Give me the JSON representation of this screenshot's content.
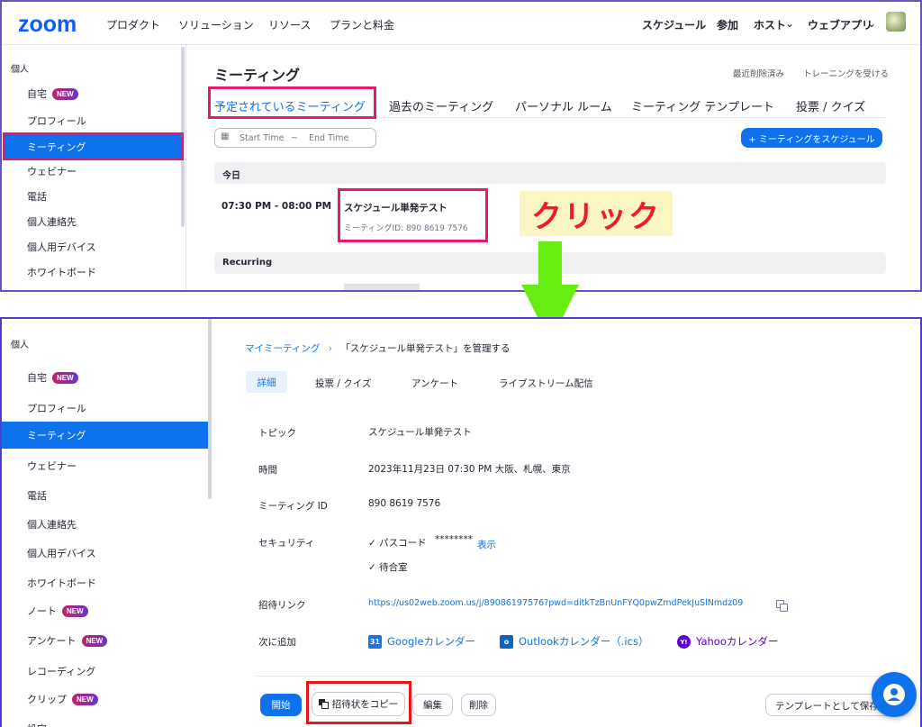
{
  "top": {
    "logo": "zoom",
    "nav_left": [
      "プロダクト",
      "ソリューション",
      "リソース",
      "プランと料金"
    ],
    "nav_right": [
      "スケジュール",
      "参加",
      "ホスト",
      "ウェブアプリ"
    ]
  },
  "sidebar1": {
    "section": "個人",
    "items": [
      "自宅",
      "プロフィール",
      "ミーティング",
      "ウェビナー",
      "電話",
      "個人連絡先",
      "個人用デバイス",
      "ホワイトボード"
    ],
    "new_badge": "NEW"
  },
  "meetings": {
    "title": "ミーティング",
    "links": [
      "最近削除済み",
      "トレーニングを受ける"
    ],
    "tabs": [
      "予定されているミーティング",
      "過去のミーティング",
      "パーソナル ルーム",
      "ミーティング テンプレート",
      "投票 / クイズ"
    ],
    "start_placeholder": "Start Time",
    "end_placeholder": "End Time",
    "date_sep": "~",
    "schedule_button": "+ ミーティングをスケジュール",
    "today_label": "今日",
    "meeting_time": "07:30 PM - 08:00 PM",
    "meeting_topic": "スケジュール単発テスト",
    "meeting_id": "ミーティングID: 890 8619 7576",
    "recurring_label": "Recurring"
  },
  "annotation": {
    "click_text": "クリック",
    "arrow_color": "#66ee11",
    "box_color": "#e6186f"
  },
  "sidebar2": {
    "section": "個人",
    "items": [
      {
        "label": "自宅",
        "new": true
      },
      {
        "label": "プロフィール",
        "new": false
      },
      {
        "label": "ミーティング",
        "new": false
      },
      {
        "label": "ウェビナー",
        "new": false
      },
      {
        "label": "電話",
        "new": false
      },
      {
        "label": "個人連絡先",
        "new": false
      },
      {
        "label": "個人用デバイス",
        "new": false
      },
      {
        "label": "ホワイトボード",
        "new": false
      },
      {
        "label": "ノート",
        "new": true
      },
      {
        "label": "アンケート",
        "new": true
      },
      {
        "label": "レコーディング",
        "new": false
      },
      {
        "label": "クリップ",
        "new": true
      },
      {
        "label": "設定",
        "new": false
      }
    ]
  },
  "detail": {
    "breadcrumb_link": "マイミーティング",
    "breadcrumb_sep": "›",
    "breadcrumb_current": "「スケジュール単発テスト」を管理する",
    "tabs": [
      "詳細",
      "投票 / クイズ",
      "アンケート",
      "ライブストリーム配信"
    ],
    "rows": {
      "topic_label": "トピック",
      "topic": "スケジュール単発テスト",
      "time_label": "時間",
      "time": "2023年11月23日 07:30 PM 大阪、札幌、東京",
      "id_label": "ミーティング ID",
      "id": "890 8619 7576",
      "security_label": "セキュリティ",
      "passcode_label": "✓ パスコード",
      "passcode_mask": "********",
      "show_link": "表示",
      "waiting_room": "✓ 待合室",
      "invite_label": "招待リンク",
      "invite_url": "https://us02web.zoom.us/j/89086197576?pwd=ditkTzBnUnFYQ0pwZmdPekJuSlNmdz09",
      "add_label": "次に追加",
      "google": "Googleカレンダー",
      "outlook": "Outlookカレンダー（.ics）",
      "yahoo": "Yahooカレンダー",
      "google_icon_text": "31",
      "yahoo_icon_text": "Y!"
    },
    "buttons": {
      "start": "開始",
      "copy": "招待状をコピー",
      "edit": "編集",
      "delete": "削除",
      "template": "テンプレートとして保存"
    }
  }
}
